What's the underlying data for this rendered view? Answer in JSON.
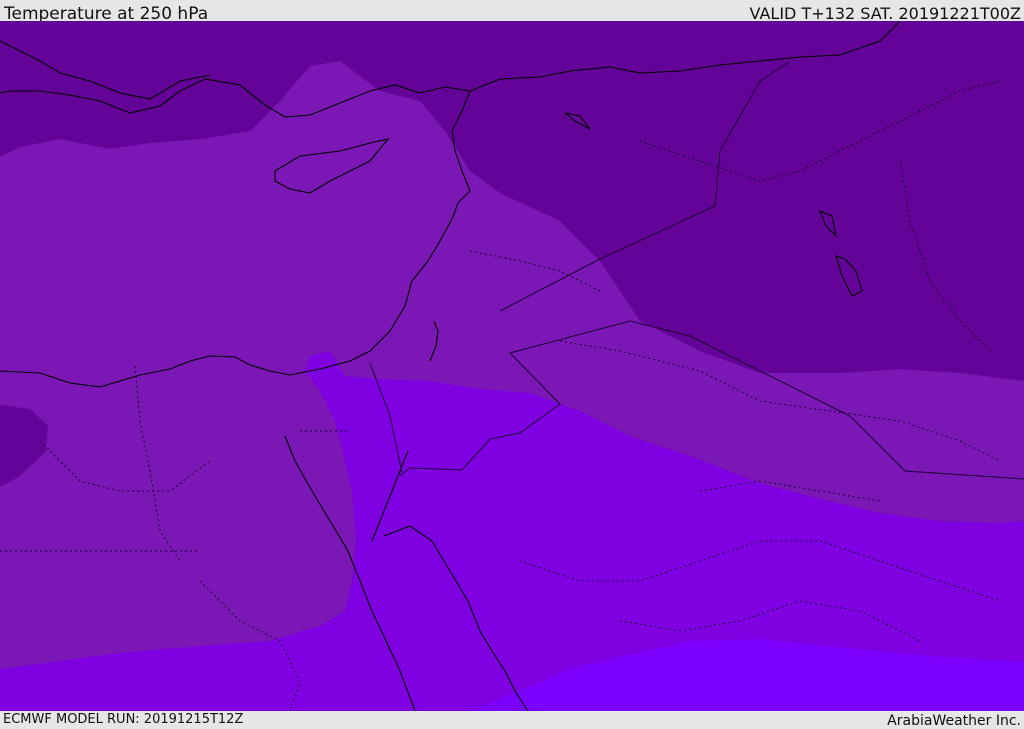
{
  "header": {
    "title": "Temperature at 250 hPa",
    "valid": "VALID T+132 SAT. 20191221T00Z"
  },
  "footer": {
    "model_run": "ECMWF MODEL RUN: 20191215T12Z",
    "credit": "ArabiaWeather Inc."
  },
  "map": {
    "colors": {
      "ocean_background": "#7a17b5",
      "cold_band": "#640397",
      "mid_band": "#7a17b5",
      "warm_band": "#7f00e0",
      "warmest_band": "#7b00ff",
      "coastline": "#000000",
      "border": "#1a0033"
    }
  }
}
